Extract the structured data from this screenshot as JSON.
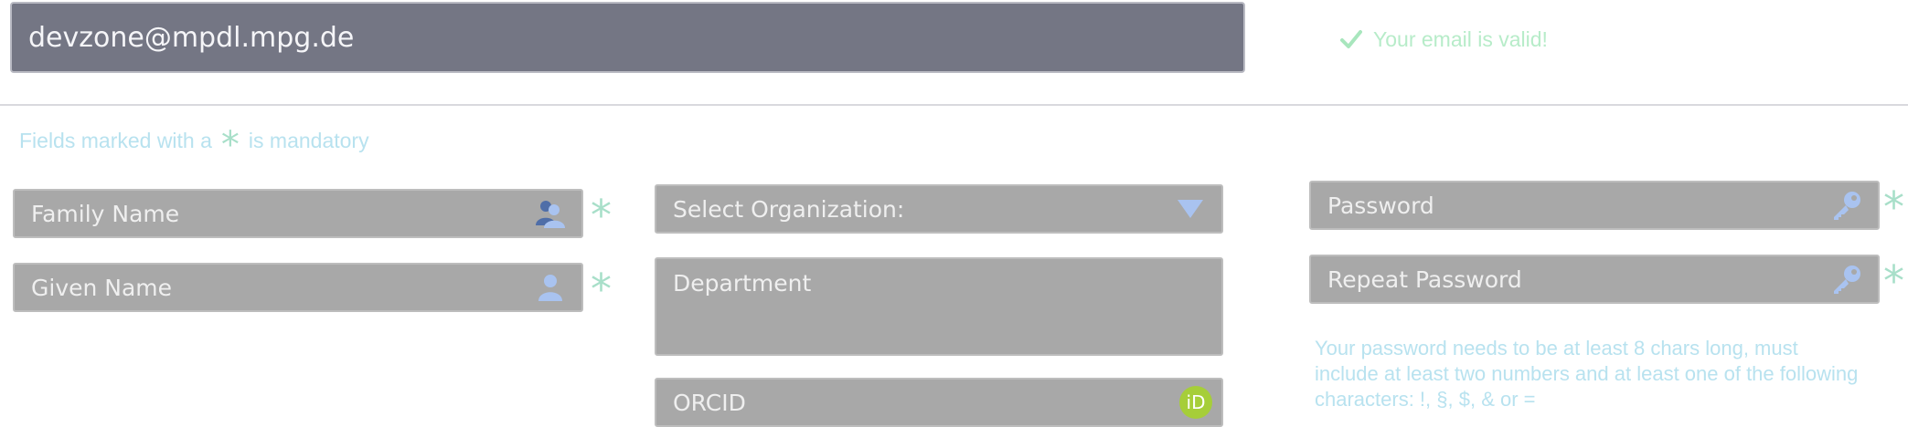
{
  "email": {
    "value": "devzone@mpdl.mpg.de",
    "status_text": "Your email is valid!",
    "status_icon": "checkmark-icon"
  },
  "note": {
    "prefix": "Fields marked with a",
    "star": "*",
    "suffix": "is mandatory"
  },
  "form": {
    "family_name": {
      "placeholder": "Family Name",
      "icon": "users-icon",
      "required": "*"
    },
    "given_name": {
      "placeholder": "Given Name",
      "icon": "user-icon",
      "required": "*"
    },
    "organization": {
      "placeholder": "Select Organization:",
      "icon": "chevron-down-icon"
    },
    "department": {
      "placeholder": "Department"
    },
    "orcid": {
      "placeholder": "ORCID",
      "icon": "orcid-icon",
      "icon_text": "iD"
    },
    "password": {
      "placeholder": "Password",
      "icon": "key-icon",
      "required": "*"
    },
    "repeat_password": {
      "placeholder": "Repeat Password",
      "icon": "key-icon",
      "required": "*"
    },
    "password_help": "Your password needs to be at least 8 chars long, must include at least two numbers and at least one of the following characters: !, §, $, & or ="
  },
  "colors": {
    "email_bg": "#747684",
    "field_bg": "#a8a8a8",
    "valid_green": "#b7ecc9",
    "note_blue": "#b8e2ef",
    "icon_blue": "#a9c3f0",
    "orcid_green": "#a6ce39"
  }
}
